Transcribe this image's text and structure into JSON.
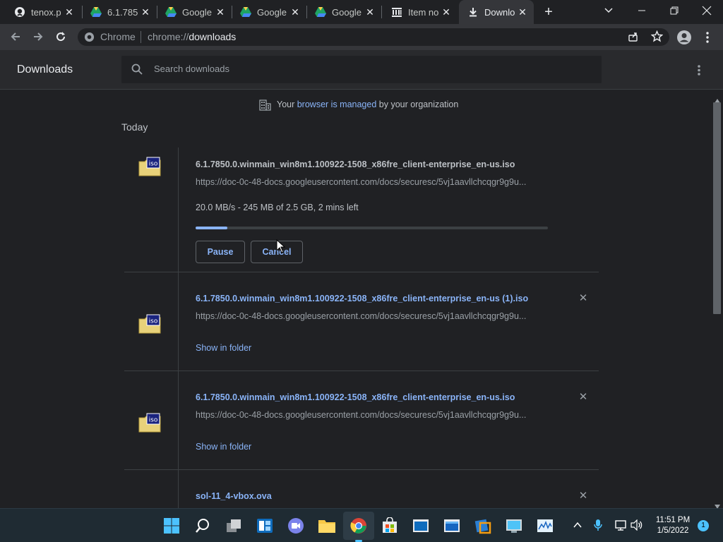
{
  "tabs": [
    {
      "title": "tenox.p",
      "icon": "github-icon"
    },
    {
      "title": "6.1.785",
      "icon": "google-drive-icon"
    },
    {
      "title": "Google",
      "icon": "google-drive-icon"
    },
    {
      "title": "Google",
      "icon": "google-drive-icon"
    },
    {
      "title": "Google",
      "icon": "google-drive-icon"
    },
    {
      "title": "Item no",
      "icon": "archive-icon"
    },
    {
      "title": "Downlo",
      "icon": "download-icon"
    }
  ],
  "omnibox": {
    "chip": "Chrome",
    "url_prefix": "chrome://",
    "url_main": "downloads"
  },
  "header": {
    "title": "Downloads",
    "search_placeholder": "Search downloads"
  },
  "managed": {
    "prefix": "Your ",
    "link": "browser is managed",
    "suffix": " by your organization"
  },
  "section": "Today",
  "downloads": [
    {
      "filename": "6.1.7850.0.winmain_win8m1.100922-1508_x86fre_client-enterprise_en-us.iso",
      "url": "https://doc-0c-48-docs.googleusercontent.com/docs/securesc/5vj1aavllchcqgr9g9u...",
      "status": "20.0 MB/s - 245 MB of 2.5 GB, 2 mins left",
      "progress": 0.09,
      "pause_label": "Pause",
      "cancel_label": "Cancel"
    },
    {
      "filename": "6.1.7850.0.winmain_win8m1.100922-1508_x86fre_client-enterprise_en-us (1).iso",
      "url": "https://doc-0c-48-docs.googleusercontent.com/docs/securesc/5vj1aavllchcqgr9g9u...",
      "action": "Show in folder"
    },
    {
      "filename": "6.1.7850.0.winmain_win8m1.100922-1508_x86fre_client-enterprise_en-us.iso",
      "url": "https://doc-0c-48-docs.googleusercontent.com/docs/securesc/5vj1aavllchcqgr9g9u...",
      "action": "Show in folder"
    },
    {
      "filename": "sol-11_4-vbox.ova"
    }
  ],
  "file_icon_label": "iso",
  "taskbar": {
    "time": "11:51 PM",
    "date": "1/5/2022",
    "notification_count": "1"
  },
  "colors": {
    "accent": "#8ab4f8",
    "background": "#202124",
    "toolbar": "#35363a",
    "taskbar": "#1f2b33"
  }
}
